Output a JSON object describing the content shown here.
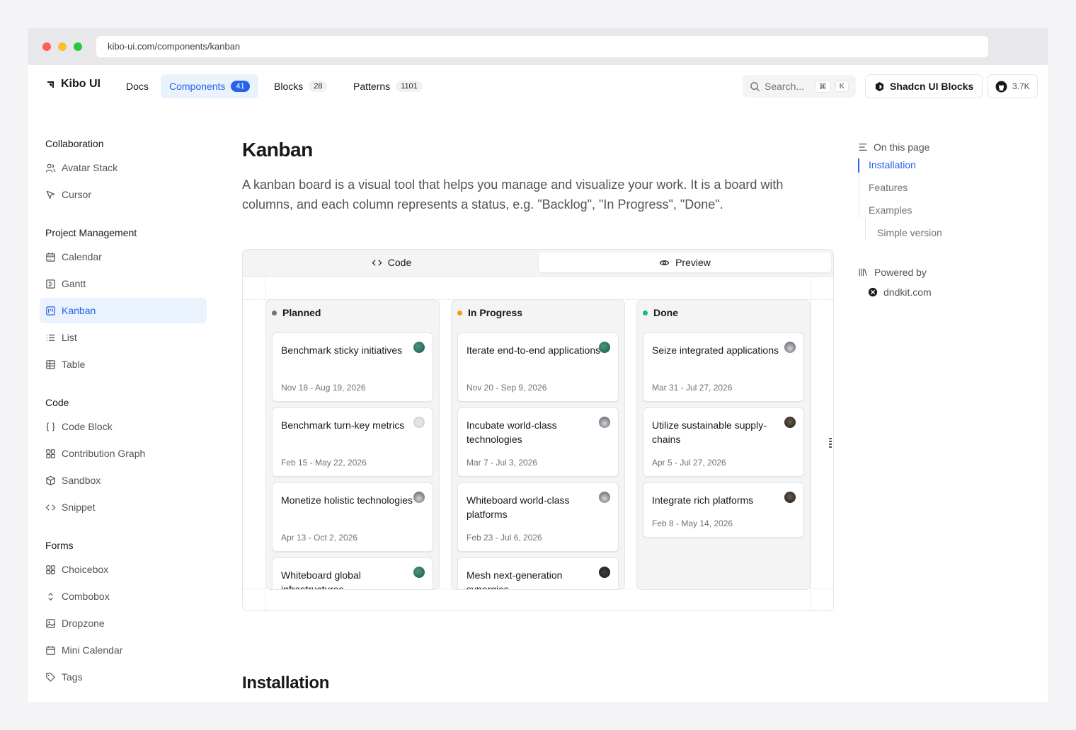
{
  "browser": {
    "url": "kibo-ui.com/components/kanban"
  },
  "colors": {
    "accent": "#2563eb",
    "accent_bg": "#eaf2fe",
    "planned": "#71717a",
    "in_progress": "#f59e0b",
    "done": "#10b981"
  },
  "topnav": {
    "brand": "Kibo UI",
    "links": [
      {
        "label": "Docs",
        "count": ""
      },
      {
        "label": "Components",
        "count": "41"
      },
      {
        "label": "Blocks",
        "count": "28"
      },
      {
        "label": "Patterns",
        "count": "1101"
      }
    ],
    "search_placeholder": "Search...",
    "search_kbd": [
      "⌘",
      "K"
    ],
    "shadcn_label": "Shadcn UI Blocks",
    "github_stars": "3.7K"
  },
  "sidebar": {
    "sections": [
      {
        "title": "Collaboration",
        "items": [
          {
            "label": "Avatar Stack",
            "icon": "users-icon"
          },
          {
            "label": "Cursor",
            "icon": "cursor-icon"
          }
        ]
      },
      {
        "title": "Project Management",
        "items": [
          {
            "label": "Calendar",
            "icon": "calendar-icon"
          },
          {
            "label": "Gantt",
            "icon": "gantt-icon"
          },
          {
            "label": "Kanban",
            "icon": "kanban-icon"
          },
          {
            "label": "List",
            "icon": "list-icon"
          },
          {
            "label": "Table",
            "icon": "table-icon"
          }
        ]
      },
      {
        "title": "Code",
        "items": [
          {
            "label": "Code Block",
            "icon": "braces-icon"
          },
          {
            "label": "Contribution Graph",
            "icon": "grid-icon"
          },
          {
            "label": "Sandbox",
            "icon": "box-icon"
          },
          {
            "label": "Snippet",
            "icon": "code-icon"
          }
        ]
      },
      {
        "title": "Forms",
        "items": [
          {
            "label": "Choicebox",
            "icon": "grid-icon"
          },
          {
            "label": "Combobox",
            "icon": "chevrons-icon"
          },
          {
            "label": "Dropzone",
            "icon": "image-icon"
          },
          {
            "label": "Mini Calendar",
            "icon": "calendar-icon"
          },
          {
            "label": "Tags",
            "icon": "tag-icon"
          }
        ]
      }
    ],
    "active": "Kanban"
  },
  "main": {
    "title": "Kanban",
    "description": "A kanban board is a visual tool that helps you manage and visualize your work. It is a board with columns, and each column represents a status, e.g. \"Backlog\", \"In Progress\", \"Done\".",
    "tabs": {
      "code": "Code",
      "preview": "Preview",
      "selected": "Preview"
    },
    "columns": [
      {
        "name": "Planned",
        "cards": [
          {
            "title": "Benchmark sticky initiatives",
            "date": "Nov 18 - Aug 19, 2026"
          },
          {
            "title": "Benchmark turn-key metrics",
            "date": "Feb 15 - May 22, 2026"
          },
          {
            "title": "Monetize holistic technologies",
            "date": "Apr 13 - Oct 2, 2026"
          },
          {
            "title": "Whiteboard global infrastructures",
            "date": ""
          }
        ]
      },
      {
        "name": "In Progress",
        "cards": [
          {
            "title": "Iterate end-to-end applications",
            "date": "Nov 20 - Sep 9, 2026"
          },
          {
            "title": "Incubate world-class technologies",
            "date": "Mar 7 - Jul 3, 2026"
          },
          {
            "title": "Whiteboard world-class platforms",
            "date": "Feb 23 - Jul 6, 2026"
          },
          {
            "title": "Mesh next-generation synergies",
            "date": ""
          }
        ]
      },
      {
        "name": "Done",
        "cards": [
          {
            "title": "Seize integrated applications",
            "date": "Mar 31 - Jul 27, 2026"
          },
          {
            "title": "Utilize sustainable supply-chains",
            "date": "Apr 5 - Jul 27, 2026"
          },
          {
            "title": "Integrate rich platforms",
            "date": "Feb 8 - May 14, 2026"
          }
        ]
      }
    ],
    "installation_heading": "Installation"
  },
  "toc": {
    "heading": "On this page",
    "items": [
      "Installation",
      "Features",
      "Examples",
      "Simple version"
    ],
    "active": "Installation",
    "powered_by": "Powered by",
    "powered_link": "dndkit.com"
  }
}
